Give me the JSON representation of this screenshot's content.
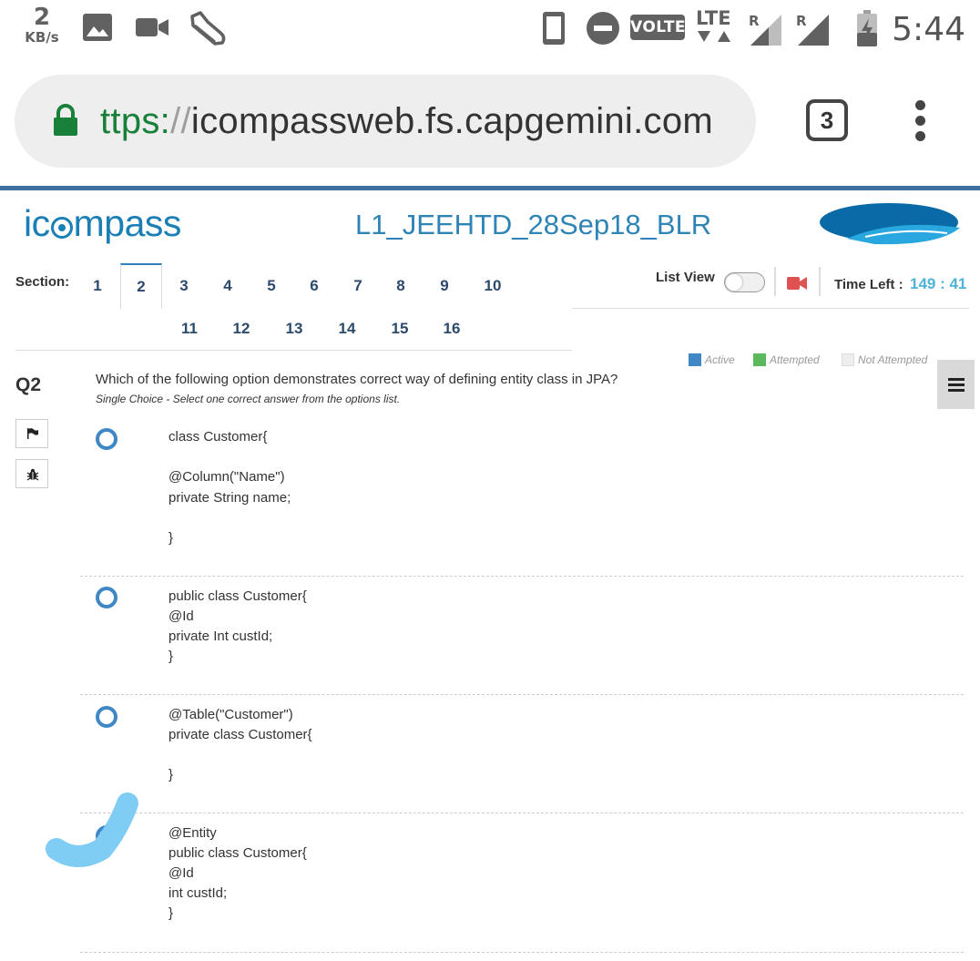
{
  "status_bar": {
    "speed_value": "2",
    "speed_unit": "KB/s",
    "volte": "VOLTE",
    "lte": "LTE",
    "roaming_1": "R",
    "roaming_2": "R",
    "time": "5:44"
  },
  "browser": {
    "url_scheme": "ttps:",
    "url_slashes": "//",
    "url_host": "icompassweb.fs.capgemini.com",
    "tab_count": "3"
  },
  "header": {
    "logo_pre": "ic",
    "logo_post": "mpass",
    "exam_title": "L1_JEEHTD_28Sep18_BLR"
  },
  "sections": {
    "label": "Section:",
    "numbers": [
      "1",
      "2",
      "3",
      "4",
      "5",
      "6",
      "7",
      "8",
      "9",
      "10",
      "11",
      "12",
      "13",
      "14",
      "15",
      "16"
    ],
    "active": "2"
  },
  "controls": {
    "list_view_label": "List View",
    "time_left_label": "Time Left :",
    "time_left_value": "149 : 41"
  },
  "legend": {
    "active": "Active",
    "attempted": "Attempted",
    "not_attempted": "Not Attempted",
    "colors": {
      "active": "#3f88c5",
      "attempted": "#5cb85c",
      "not_attempted": "#eeeeee"
    }
  },
  "question": {
    "number": "Q2",
    "text": "Which of the following option demonstrates correct way of defining entity class in JPA?",
    "subtext": "Single Choice - Select one correct answer from the options list.",
    "options": [
      {
        "lines": [
          "class Customer{",
          "",
          "@Column(\"Name\")",
          "private String name;",
          "",
          "}"
        ]
      },
      {
        "lines": [
          "public class Customer{",
          "@Id",
          "private Int custId;",
          "}"
        ]
      },
      {
        "lines": [
          "@Table(\"Customer\")",
          "private class Customer{",
          "",
          "}"
        ]
      },
      {
        "lines": [
          "@Entity",
          "public class Customer{",
          "@Id",
          "int custId;",
          "}"
        ]
      }
    ]
  },
  "icons": {
    "status": [
      "image-icon",
      "video-icon",
      "shoe-icon",
      "phone-icon",
      "dnd-icon",
      "signal-icon",
      "battery-icon"
    ],
    "page": [
      "lock-icon",
      "menu-icon",
      "camera-icon",
      "flag-icon",
      "bug-icon"
    ]
  }
}
